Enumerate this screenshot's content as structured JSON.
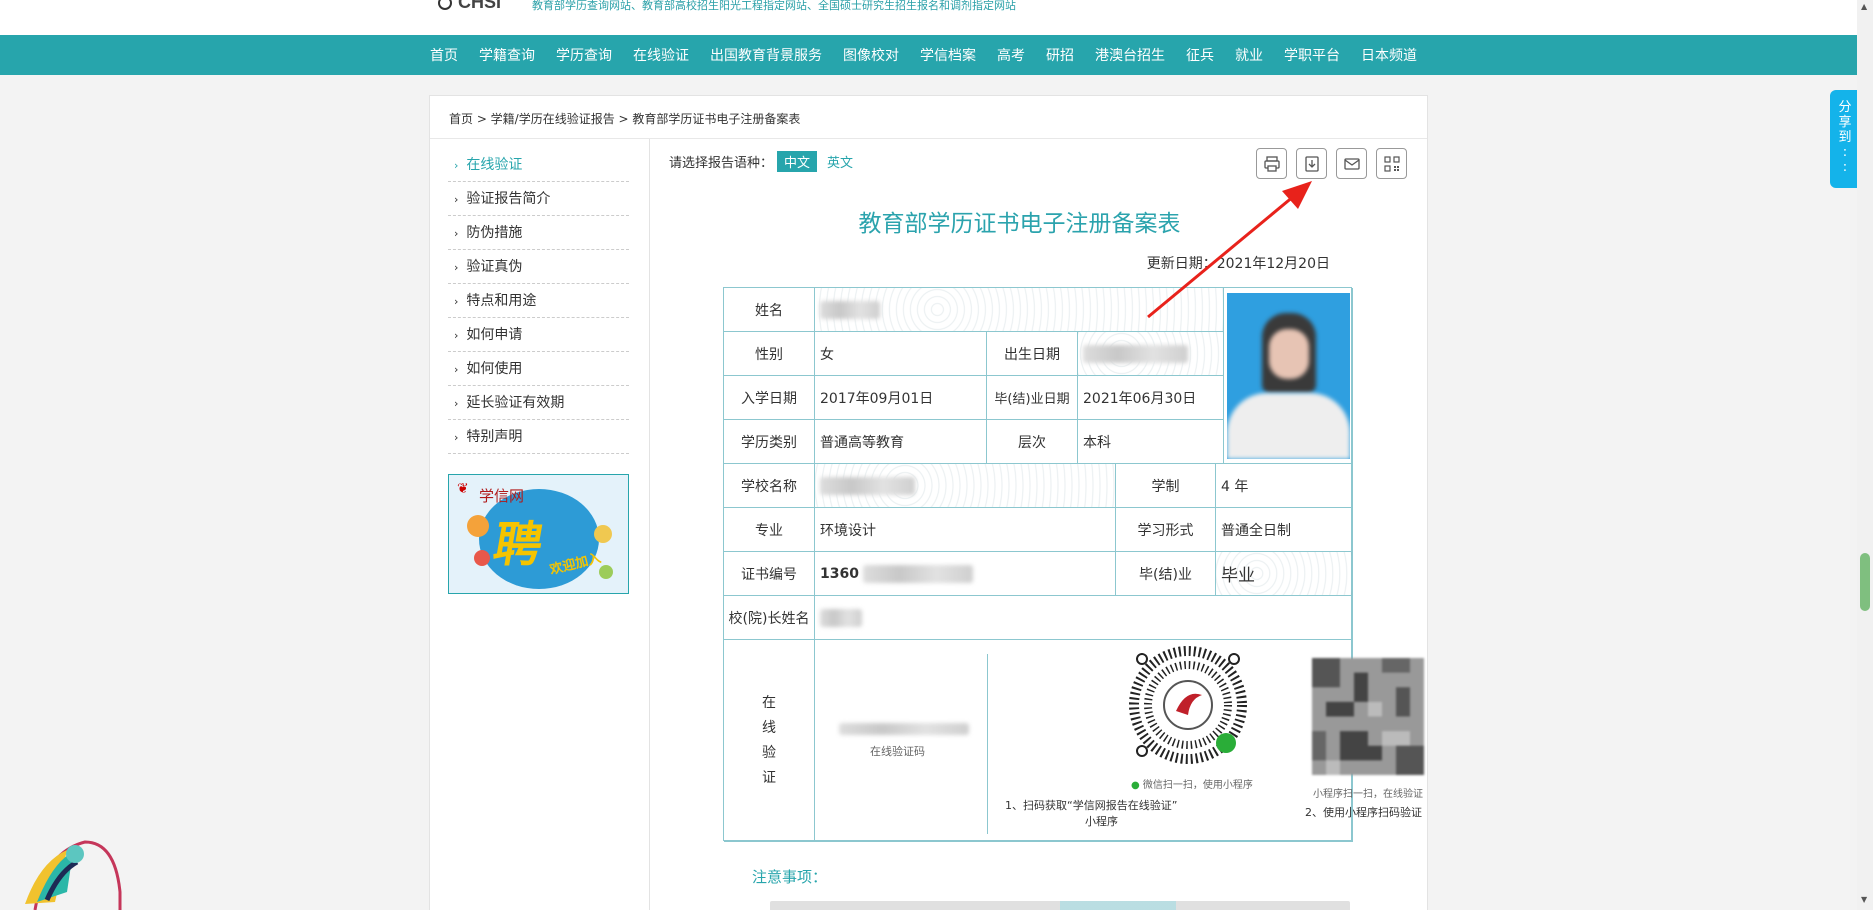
{
  "header": {
    "logo_text": "CHSI",
    "tagline": "教育部学历查询网站、教育部高校招生阳光工程指定网站、全国硕士研究生招生报名和调剂指定网站"
  },
  "nav": [
    "首页",
    "学籍查询",
    "学历查询",
    "在线验证",
    "出国教育背景服务",
    "图像校对",
    "学信档案",
    "高考",
    "研招",
    "港澳台招生",
    "征兵",
    "就业",
    "学职平台",
    "日本频道"
  ],
  "breadcrumb": "首页 > 学籍/学历在线验证报告 > 教育部学历证书电子注册备案表",
  "sidebar": [
    {
      "label": "在线验证",
      "active": true
    },
    {
      "label": "验证报告简介"
    },
    {
      "label": "防伪措施"
    },
    {
      "label": "验证真伪"
    },
    {
      "label": "特点和用途"
    },
    {
      "label": "如何申请"
    },
    {
      "label": "如何使用"
    },
    {
      "label": "延长验证有效期"
    },
    {
      "label": "特别声明"
    }
  ],
  "banner": {
    "brand": "学信网",
    "big": "聘",
    "join": "欢迎加入"
  },
  "lang": {
    "label": "请选择报告语种：",
    "zh": "中文",
    "en": "英文"
  },
  "tools": {
    "print_icon": "printer-icon",
    "download_icon": "download-icon",
    "mail_icon": "mail-icon",
    "qr_icon": "qrcode-icon"
  },
  "doc": {
    "title": "教育部学历证书电子注册备案表",
    "update": "更新日期：2021年12月20日",
    "labels": {
      "name": "姓名",
      "gender": "性别",
      "birth": "出生日期",
      "enroll": "入学日期",
      "graduate_date": "毕(结)业日期",
      "category": "学历类别",
      "level": "层次",
      "school": "学校名称",
      "duration": "学制",
      "major": "专业",
      "study_form": "学习形式",
      "cert_no": "证书编号",
      "graduation": "毕(结)业",
      "president": "校(院)长姓名"
    },
    "values": {
      "gender": "女",
      "enroll": "2017年09月01日",
      "graduate_date": "2021年06月30日",
      "category": "普通高等教育",
      "level": "本科",
      "duration": "4 年",
      "major": "环境设计",
      "study_form": "普通全日制",
      "cert_prefix": "1360",
      "graduation": "毕业"
    },
    "verify": {
      "label_chars": [
        "在",
        "线",
        "验",
        "证"
      ],
      "code_caption": "在线验证码",
      "qr1_caption": "微信扫一扫，使用小程序",
      "step1_line1": "1、扫码获取“学信网报告在线验证”",
      "step1_line2": "小程序",
      "qr2_caption": "小程序扫一扫，在线验证",
      "step2": "2、使用小程序扫码验证"
    },
    "notice_title": "注意事项："
  },
  "share": [
    "分",
    "享",
    "到",
    ":",
    ":"
  ],
  "colors": {
    "teal": "#27a5ac",
    "share": "#14b3ea",
    "arrow": "#e8221b"
  }
}
